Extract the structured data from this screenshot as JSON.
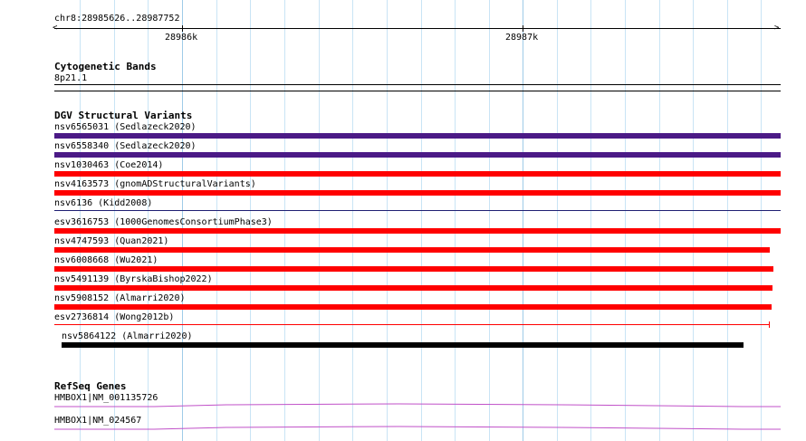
{
  "position_label": "chr8:28985626..28987752",
  "ruler": {
    "ticks": [
      {
        "label": "28986k"
      },
      {
        "label": "28987k"
      }
    ]
  },
  "colors": {
    "grid": "#c9e4f5",
    "grid_major": "#9fcbe8",
    "purple": "#4b1a86",
    "red": "#ff0000",
    "navy": "#1f1f73",
    "black": "#000000",
    "gene": "#c050c8"
  },
  "cytoband": {
    "title": "Cytogenetic Bands",
    "band": "8p21.1"
  },
  "dgv": {
    "title": "DGV Structural Variants",
    "items": [
      {
        "label": "nsv6565031 (Sedlazeck2020)",
        "color": "#4b1a86"
      },
      {
        "label": "nsv6558340 (Sedlazeck2020)",
        "color": "#4b1a86"
      },
      {
        "label": "nsv1030463 (Coe2014)",
        "color": "#ff0000"
      },
      {
        "label": "nsv4163573 (gnomADStructuralVariants)",
        "color": "#ff0000"
      },
      {
        "label": "nsv6136 (Kidd2008)",
        "color": "#1f1f73"
      },
      {
        "label": "esv3616753 (1000GenomesConsortiumPhase3)",
        "color": "#ff0000"
      },
      {
        "label": "nsv4747593 (Quan2021)",
        "color": "#ff0000"
      },
      {
        "label": "nsv6008668 (Wu2021)",
        "color": "#ff0000"
      },
      {
        "label": "nsv5491139 (ByrskaBishop2022)",
        "color": "#ff0000"
      },
      {
        "label": "nsv5908152 (Almarri2020)",
        "color": "#ff0000"
      },
      {
        "label": "esv2736814 (Wong2012b)",
        "color": "#ff0000"
      },
      {
        "label": "nsv5864122 (Almarri2020)",
        "color": "#000000"
      }
    ]
  },
  "refseq": {
    "title": "RefSeq Genes",
    "genes": [
      {
        "label": "HMBOX1|NM_001135726"
      },
      {
        "label": "HMBOX1|NM_024567"
      }
    ]
  }
}
